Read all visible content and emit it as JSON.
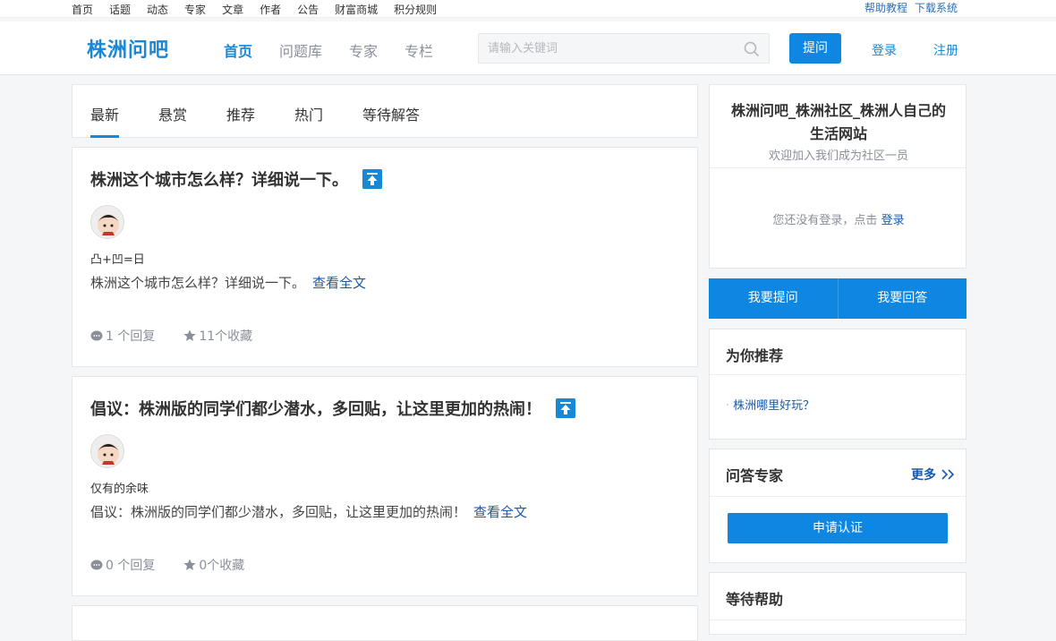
{
  "topbar": {
    "links": [
      "首页",
      "话题",
      "动态",
      "专家",
      "文章",
      "作者",
      "公告",
      "财富商城",
      "积分规则"
    ],
    "right_links": [
      "帮助教程",
      "下载系统"
    ]
  },
  "header": {
    "logo": "株洲问吧",
    "nav": [
      "首页",
      "问题库",
      "专家",
      "专栏"
    ],
    "search_placeholder": "请输入关键词",
    "ask_label": "提问",
    "login_label": "登录",
    "register_label": "注册"
  },
  "tabs": [
    "最新",
    "悬赏",
    "推荐",
    "热门",
    "等待解答"
  ],
  "questions": [
    {
      "title": "株洲这个城市怎么样？详细说一下。",
      "author": "凸+凹=日",
      "excerpt": "株洲这个城市怎么样？详细说一下。",
      "read_more": "查看全文",
      "replies": "1 个回复",
      "favorites": "11个收藏"
    },
    {
      "title": "倡议：株洲版的同学们都少潜水，多回贴，让这里更加的热闹！",
      "author": "仅有的余味",
      "excerpt": "倡议：株洲版的同学们都少潜水，多回贴，让这里更加的热闹！",
      "read_more": "查看全文",
      "replies": "0 个回复",
      "favorites": "0个收藏"
    }
  ],
  "sidebar": {
    "site_name": "株洲问吧_株洲社区_株洲人自己的生活网站",
    "site_sub": "欢迎加入我们成为社区一员",
    "login_tip": "您还没有登录，点击",
    "login_link": "登录",
    "ask_btn": "我要提问",
    "answer_btn": "我要回答",
    "recommend_title": "为你推荐",
    "recommend_items": [
      "株洲哪里好玩？"
    ],
    "experts_title": "问答专家",
    "more_label": "更多",
    "apply_label": "申请认证",
    "waiting_title": "等待帮助"
  },
  "colors": {
    "accent": "#0e87e3",
    "link": "#1a5aa8"
  }
}
